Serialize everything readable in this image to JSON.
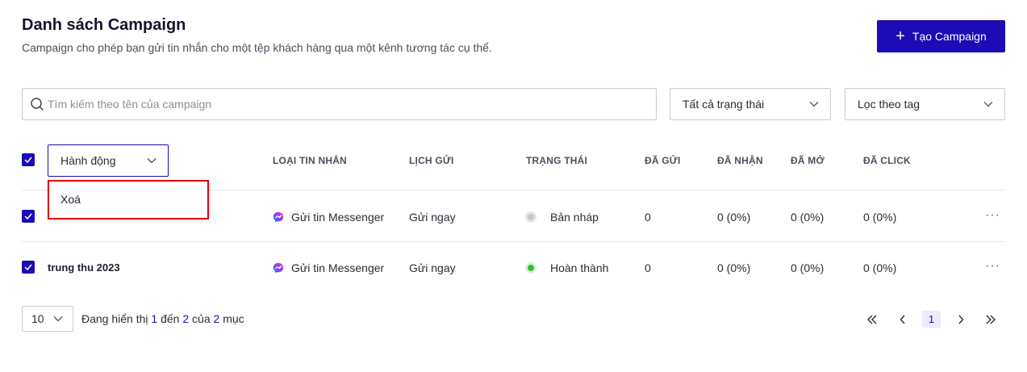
{
  "header": {
    "title": "Danh sách Campaign",
    "subtitle": "Campaign cho phép bạn gửi tin nhắn cho một tệp khách hàng qua một kênh tương tác cụ thể.",
    "create_button": "Tạo Campaign"
  },
  "filters": {
    "search_placeholder": "Tìm kiếm theo tên của campaign",
    "status_select": "Tất cả trạng thái",
    "tag_select": "Lọc theo tag"
  },
  "table": {
    "action_dropdown": "Hành động",
    "columns": [
      "LOẠI TIN NHẮN",
      "LỊCH GỬI",
      "TRẠNG THÁI",
      "ĐÃ GỬI",
      "ĐÃ NHẬN",
      "ĐÃ MỞ",
      "ĐÃ CLICK"
    ],
    "rows": [
      {
        "name": "",
        "type": "Gửi tin Messenger",
        "schedule": "Gửi ngay",
        "status": "Bản nháp",
        "status_color": "#c4c6cc",
        "sent": "0",
        "received": "0 (0%)",
        "opened": "0 (0%)",
        "clicked": "0 (0%)",
        "more": "···"
      },
      {
        "name": "trung thu 2023",
        "type": "Gửi tin Messenger",
        "schedule": "Gửi ngay",
        "status": "Hoàn thành",
        "status_color": "#2ec22e",
        "sent": "0",
        "received": "0 (0%)",
        "opened": "0 (0%)",
        "clicked": "0 (0%)",
        "more": "···"
      }
    ]
  },
  "action_menu": {
    "items": [
      "Xoá"
    ]
  },
  "pagination": {
    "page_size": "10",
    "info_prefix": "Đang hiển thị",
    "from": "1",
    "to_word": "đến",
    "to": "2",
    "of_word": "của",
    "total": "2",
    "suffix": "mục",
    "current_page": "1"
  },
  "colors": {
    "accent": "#1d0bb5",
    "highlight_border": "#e4000f"
  }
}
